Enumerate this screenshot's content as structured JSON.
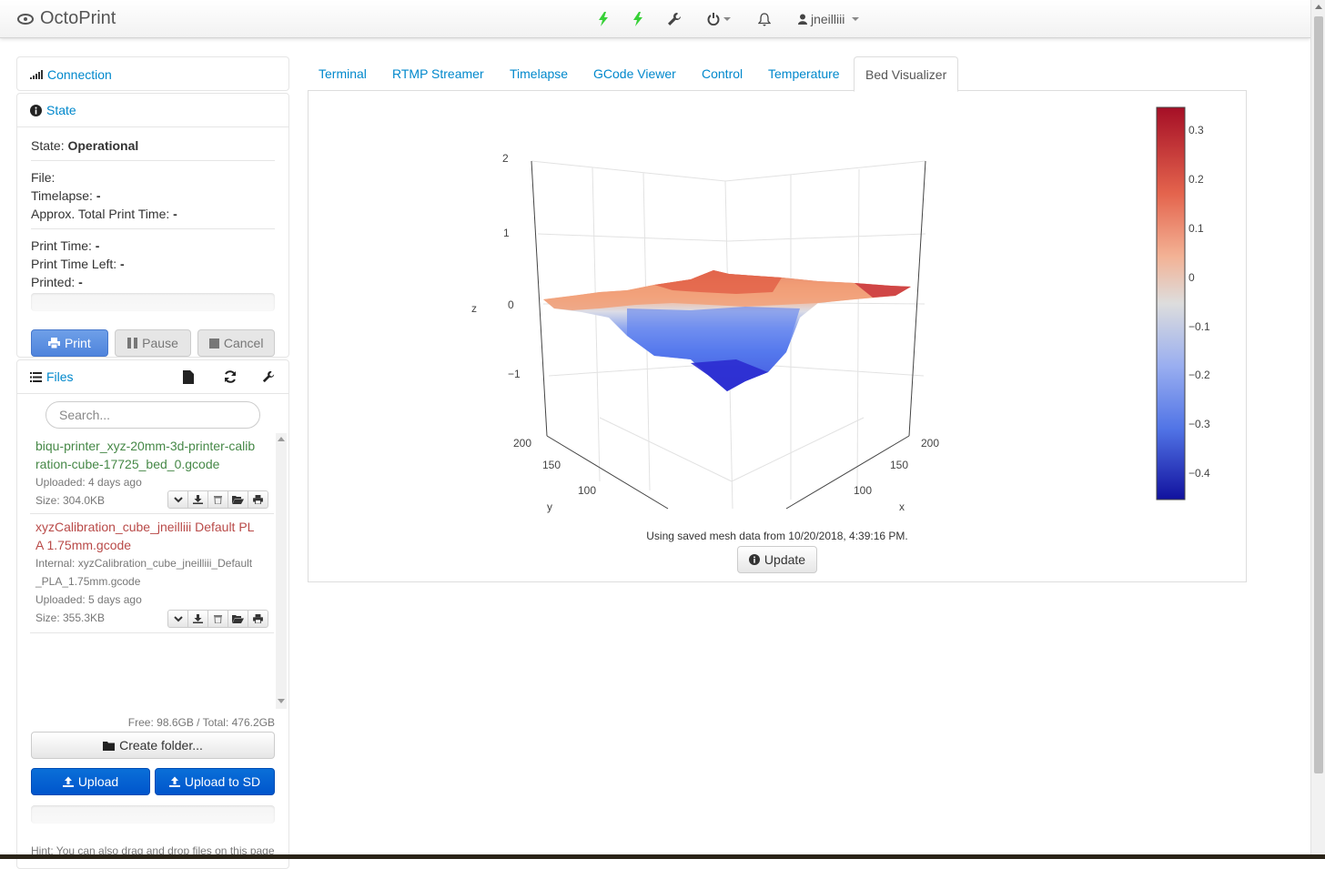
{
  "navbar": {
    "brand": "OctoPrint",
    "user": "jneilliii",
    "icons": [
      "bolt-icon",
      "bolt-icon",
      "wrench-icon",
      "power-icon",
      "bell-icon",
      "user-icon"
    ]
  },
  "connection": {
    "title": "Connection"
  },
  "state": {
    "title": "State",
    "state_label": "State:",
    "state_value": "Operational",
    "file_label": "File:",
    "timelapse_label": "Timelapse:",
    "timelapse_value": "-",
    "approx_label": "Approx. Total Print Time:",
    "approx_value": "-",
    "print_time_label": "Print Time:",
    "print_time_value": "-",
    "time_left_label": "Print Time Left:",
    "time_left_value": "-",
    "printed_label": "Printed:",
    "printed_value": "-",
    "buttons": {
      "print": "Print",
      "pause": "Pause",
      "cancel": "Cancel"
    }
  },
  "files": {
    "title": "Files",
    "search_placeholder": "Search...",
    "items": [
      {
        "name": "biqu-printer_xyz-20mm-3d-printer-calibration-cube-17725_bed_0.gcode",
        "uploaded": "Uploaded: 4 days ago",
        "size": "Size: 304.0KB",
        "color": "#468847"
      },
      {
        "name": "xyzCalibration_cube_jneilliii Default PLA 1.75mm.gcode",
        "internal": "Internal: xyzCalibration_cube_jneilliii_Default_PLA_1.75mm.gcode",
        "uploaded": "Uploaded: 5 days ago",
        "size": "Size: 355.3KB",
        "color": "#b94a48"
      }
    ],
    "free_total": "Free: 98.6GB / Total: 476.2GB",
    "create_folder": "Create folder...",
    "upload": "Upload",
    "upload_sd": "Upload to SD",
    "hint": "Hint: You can also drag and drop files on this page"
  },
  "tabs": [
    "Terminal",
    "RTMP Streamer",
    "Timelapse",
    "GCode Viewer",
    "Control",
    "Temperature",
    "Bed Visualizer"
  ],
  "active_tab": "Bed Visualizer",
  "bed_visualizer": {
    "mesh_text": "Using saved mesh data from 10/20/2018, 4:39:16 PM.",
    "update_button": "Update"
  },
  "chart_data": {
    "type": "surface",
    "axes": {
      "z": {
        "label": "z",
        "ticks": [
          "2",
          "1",
          "0",
          "−1"
        ]
      },
      "y": {
        "label": "y",
        "ticks": [
          "200",
          "150",
          "100"
        ]
      },
      "x": {
        "label": "x",
        "ticks": [
          "200",
          "150",
          "100"
        ]
      }
    },
    "colorbar": {
      "ticks": [
        "0.3",
        "0.2",
        "0.1",
        "0",
        "−0.1",
        "−0.2",
        "−0.3",
        "−0.4"
      ],
      "range": [
        -0.45,
        0.35
      ],
      "colors": [
        "#b2182b",
        "#ef8a62",
        "#dddddd",
        "#6f8fe8",
        "#1a1ab5"
      ]
    }
  }
}
